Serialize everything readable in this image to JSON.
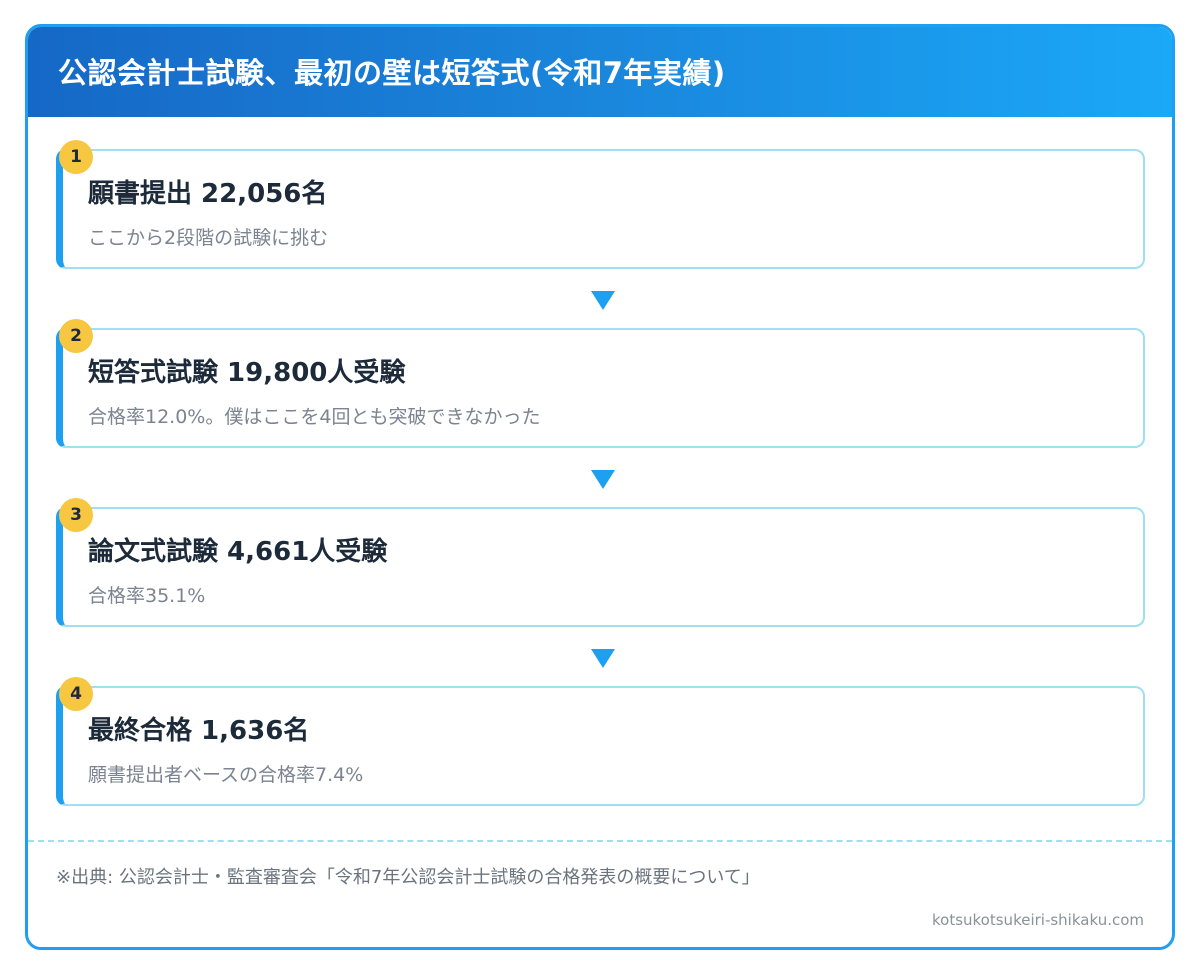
{
  "header": {
    "title": "公認会計士試験、最初の壁は短答式(令和7年実績)"
  },
  "steps": [
    {
      "number": "1",
      "title": "願書提出 22,056名",
      "desc": "ここから2段階の試験に挑む"
    },
    {
      "number": "2",
      "title": "短答式試験 19,800人受験",
      "desc": "合格率12.0%。僕はここを4回とも突破できなかった"
    },
    {
      "number": "3",
      "title": "論文式試験 4,661人受験",
      "desc": "合格率35.1%"
    },
    {
      "number": "4",
      "title": "最終合格 1,636名",
      "desc": "願書提出者ベースの合格率7.4%"
    }
  ],
  "footer": {
    "source": "※出典: 公認会計士・監査審査会「令和7年公認会計士試験の合格発表の概要について」",
    "site": "kotsukotsukeiri-shikaku.com"
  },
  "colors": {
    "accent": "#1ea0f0",
    "badge": "#f8c742",
    "step_border": "#9edff0"
  }
}
